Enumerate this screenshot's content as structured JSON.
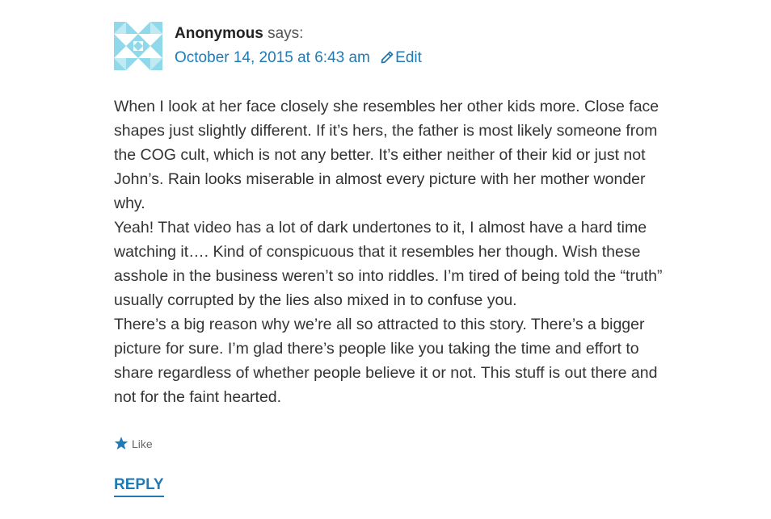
{
  "comment": {
    "author": "Anonymous",
    "says": "says:",
    "date": "October 14, 2015 at 6:43 am",
    "edit_label": "Edit",
    "paragraphs": [
      "When I look at her face closely she resembles her other kids more. Close face shapes just slightly different. If it’s hers, the father is most likely someone from the COG cult, which is not any better. It’s either neither of their kid or just not John’s. Rain looks miserable in almost every picture with her mother wonder why.",
      "Yeah! That video has a lot of dark undertones to it, I almost have a hard time watching it…. Kind of conspicuous that it resembles her though. Wish these asshole in the business weren’t so into riddles. I’m tired of being told the “truth” usually corrupted by the lies also mixed in to confuse you.",
      "There’s a big reason why we’re all so attracted to this story. There’s a bigger picture for sure. I’m glad there’s people like you taking the time and effort to share regardless of whether people believe it or not. This stuff is out there and not for the faint hearted."
    ],
    "like_label": "Like",
    "reply_label": "REPLY"
  },
  "colors": {
    "link": "#1f7ab5",
    "text": "#333333",
    "avatar": "#8fd9ea"
  },
  "icons": {
    "avatar": "identicon-avatar",
    "edit": "pencil-icon",
    "like": "star-icon"
  }
}
